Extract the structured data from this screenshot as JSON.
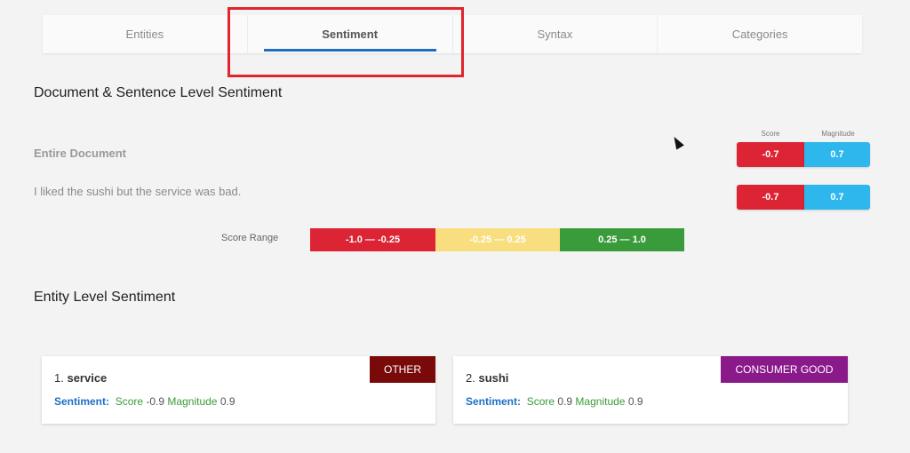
{
  "tabs": [
    {
      "label": "Entities"
    },
    {
      "label": "Sentiment"
    },
    {
      "label": "Syntax"
    },
    {
      "label": "Categories"
    }
  ],
  "document_section": {
    "title": "Document & Sentence Level Sentiment",
    "score_header": "Score",
    "magnitude_header": "Magnitude",
    "rows": [
      {
        "label": "Entire Document",
        "score": "-0.7",
        "magnitude": "0.7"
      },
      {
        "label": "I liked the sushi but the service was bad.",
        "score": "-0.7",
        "magnitude": "0.7"
      }
    ]
  },
  "score_range": {
    "label": "Score Range",
    "ranges": [
      {
        "text": "-1.0 — -0.25",
        "color": "#dc2434"
      },
      {
        "text": "-0.25 — 0.25",
        "color": "#f8de7e"
      },
      {
        "text": "0.25 — 1.0",
        "color": "#3a9b3a"
      }
    ]
  },
  "entity_section": {
    "title": "Entity Level Sentiment",
    "entities": [
      {
        "index": "1.",
        "name": "service",
        "badge": "OTHER",
        "badge_color": "#7a0a0a",
        "sentiment_label": "Sentiment:",
        "score_label": "Score",
        "score": "-0.9",
        "magnitude_label": "Magnitude",
        "magnitude": "0.9"
      },
      {
        "index": "2.",
        "name": "sushi",
        "badge": "CONSUMER GOOD",
        "badge_color": "#8a1a8a",
        "sentiment_label": "Sentiment:",
        "score_label": "Score",
        "score": "0.9",
        "magnitude_label": "Magnitude",
        "magnitude": "0.9"
      }
    ]
  }
}
